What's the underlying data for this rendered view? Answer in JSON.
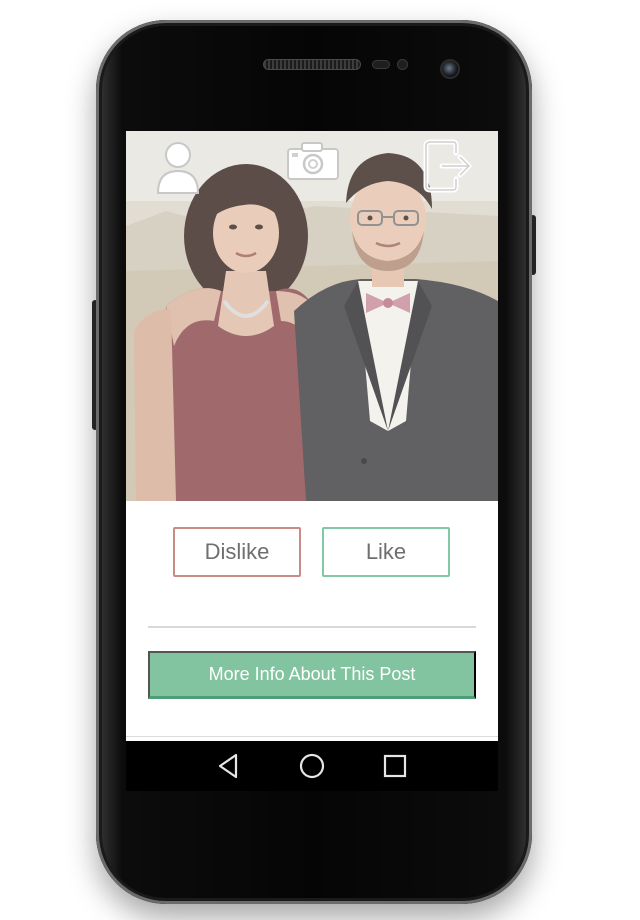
{
  "header": {
    "icons": [
      "profile-icon",
      "camera-icon",
      "exit-icon"
    ]
  },
  "actions": {
    "dislike_label": "Dislike",
    "like_label": "Like",
    "more_info_label": "More Info About This Post"
  },
  "navbar": {
    "icons": [
      "back-icon",
      "home-icon",
      "recents-icon"
    ]
  },
  "colors": {
    "dislike_border": "#c98b86",
    "like_border": "#82c7a6",
    "primary_button": "#82c4a0",
    "primary_button_shadow": "#4f9d76"
  }
}
